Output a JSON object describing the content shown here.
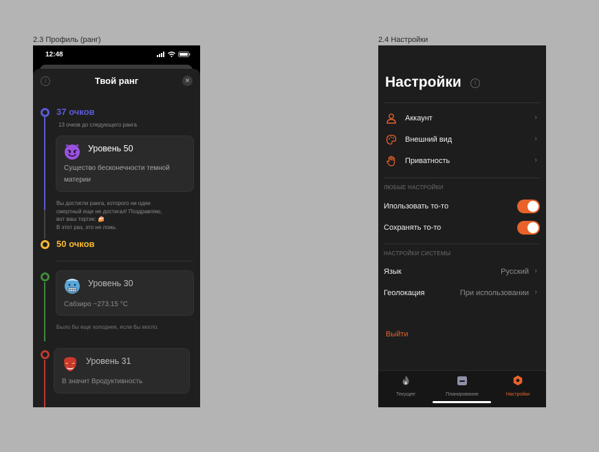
{
  "frames": {
    "rank_label": "2.3 Профиль (ранг)",
    "settings_label": "2.4 Настройки"
  },
  "rank_screen": {
    "status_time": "12:48",
    "title": "Твой ранг",
    "info_icon": "info-icon",
    "close_icon": "close-icon",
    "ranks": [
      {
        "points": "37 очков",
        "color": "#5b5bd6",
        "next_rank_text": "13 очков до следующего ранга",
        "level": "Уровень 50",
        "description_line1": "Существо бесконечности темной",
        "description_line2": "материи",
        "emoji": "smiling-devil-emoji",
        "note_line1": "Вы достигли ранга, которого ни один",
        "note_line2": "смертный еще не достигал! Поздравляю,",
        "note_line3": "вот ваш тортик: 🍰",
        "note_line4": "В этот раз, это не ложь."
      },
      {
        "points": "50 очков",
        "color": "#f5b82e"
      },
      {
        "color": "#3e8a3e",
        "level": "Уровень 30",
        "description": "Сабзиро −273.15 °C",
        "emoji": "freezing-face-emoji",
        "note": "Было бы еще холоднее, если бы могло."
      },
      {
        "color": "#b83a32",
        "level": "Уровень 31",
        "description": "В значит Вродуктивность",
        "emoji": "red-mask-emoji"
      }
    ]
  },
  "settings_screen": {
    "title": "Настройки",
    "accent_color": "#e8622a",
    "main_rows": [
      {
        "label": "Аккаунт",
        "icon": "person-icon"
      },
      {
        "label": "Внешний вид",
        "icon": "palette-icon"
      },
      {
        "label": "Приватность",
        "icon": "hand-icon"
      }
    ],
    "section_any": "ЛЮБЫЕ НАСТРОЙКИ",
    "toggles": [
      {
        "label": "Ипользовать то-то",
        "on": true
      },
      {
        "label": "Сохранять то-то",
        "on": true
      }
    ],
    "section_system": "НАСТРОЙКИ СИСТЕМЫ",
    "system_rows": [
      {
        "label": "Язык",
        "value": "Русский"
      },
      {
        "label": "Геолокация",
        "value": "При использовании"
      }
    ],
    "logout": "Выйти",
    "tabs": [
      {
        "label": "Текущее",
        "icon": "flame-icon",
        "active": false
      },
      {
        "label": "Планирование",
        "icon": "calendar-icon",
        "active": false
      },
      {
        "label": "Настройки",
        "icon": "settings-hexagon-icon",
        "active": true
      }
    ]
  }
}
